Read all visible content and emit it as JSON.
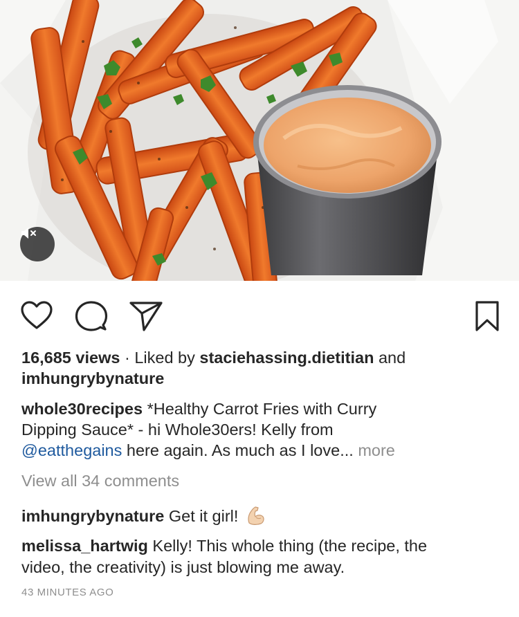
{
  "post": {
    "media": {
      "description_icon": "mute-icon"
    },
    "actions": {
      "like_icon": "heart-icon",
      "comment_icon": "comment-icon",
      "share_icon": "paper-plane-icon",
      "save_icon": "bookmark-icon"
    },
    "stats": {
      "views": "16,685 views",
      "liked_by_prefix": "Liked by",
      "liked_by_user": "staciehassing.dietitian",
      "and": "and",
      "second_user": "imhungrybynature"
    },
    "caption": {
      "author": "whole30recipes",
      "line1_text": "*Healthy Carrot Fries with Curry",
      "line2_text": "Dipping Sauce* - hi Whole30ers! Kelly from",
      "mention": "@eatthegains",
      "line3_text": "here again. As much as I love...",
      "more": "more"
    },
    "view_all_comments": "View all 34 comments",
    "comments": [
      {
        "user": "imhungrybynature",
        "text": "Get it girl!",
        "emoji": "flexed-biceps-icon"
      },
      {
        "user": "melissa_hartwig",
        "text_line1": "Kelly! This whole thing (the recipe, the",
        "text_line2": "video, the creativity) is just blowing me away."
      }
    ],
    "timestamp": "43 MINUTES AGO"
  },
  "colors": {
    "text": "#262626",
    "muted": "#8e8e8e",
    "link": "#1f5a9e",
    "carrot": "#e8621f"
  }
}
